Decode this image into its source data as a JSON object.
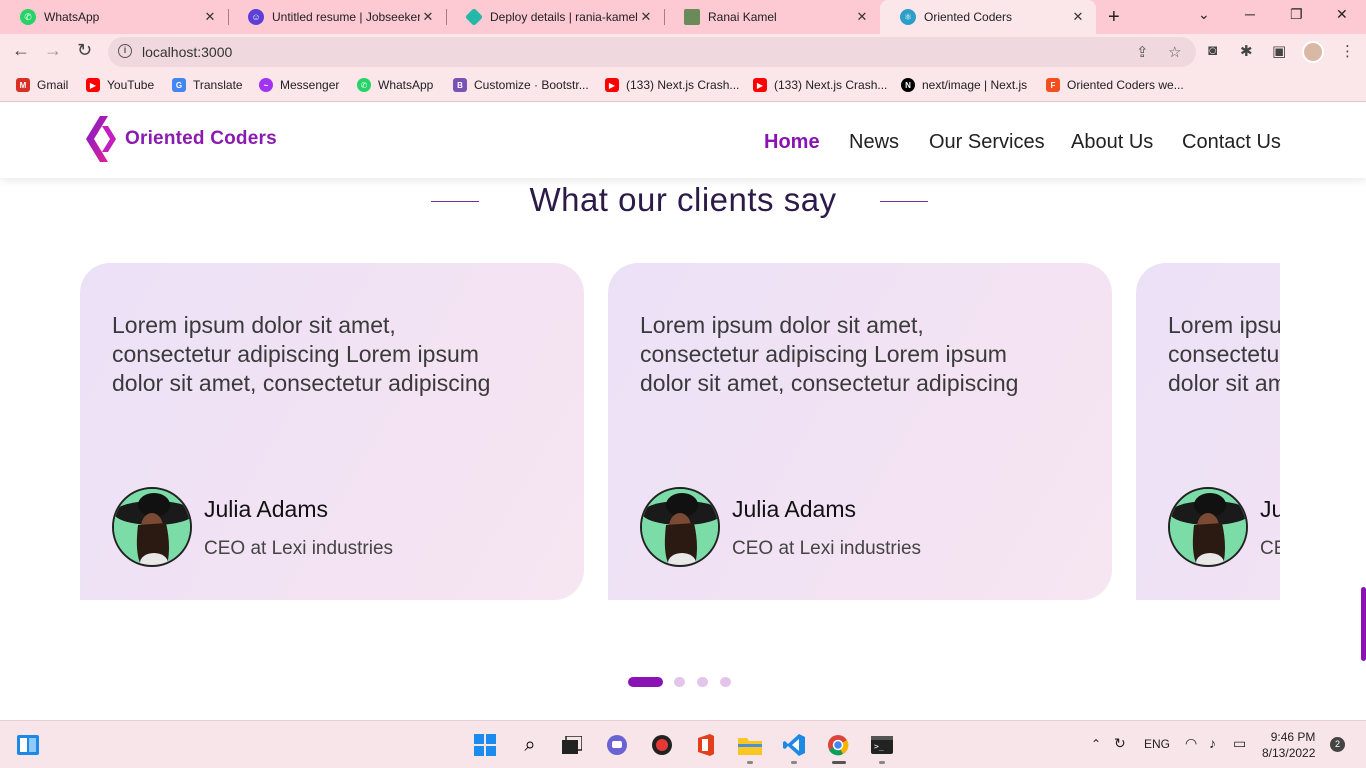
{
  "browser": {
    "tabs": [
      {
        "title": "WhatsApp",
        "icon": "whatsapp-icon",
        "color": "#25d366"
      },
      {
        "title": "Untitled resume | Jobseeker",
        "icon": "jobseeker-icon",
        "color": "#5b3fd8"
      },
      {
        "title": "Deploy details | rania-kamel-",
        "icon": "netlify-icon",
        "color": "#25b8a8"
      },
      {
        "title": "Ranai Kamel",
        "icon": "portfolio-icon",
        "color": "#6a8a5a"
      },
      {
        "title": "Oriented Coders",
        "icon": "react-icon",
        "color": "#2b9fc9"
      }
    ],
    "url": "localhost:3000",
    "bookmarks": [
      {
        "label": "Gmail",
        "icon": "gmail-icon",
        "color": "#d93025"
      },
      {
        "label": "YouTube",
        "icon": "youtube-icon",
        "color": "#ff0000"
      },
      {
        "label": "Translate",
        "icon": "translate-icon",
        "color": "#4285f4"
      },
      {
        "label": "Messenger",
        "icon": "messenger-icon",
        "color": "#a034f0"
      },
      {
        "label": "WhatsApp",
        "icon": "whatsapp-icon",
        "color": "#25d366"
      },
      {
        "label": "Customize · Bootstr...",
        "icon": "bootstrap-icon",
        "color": "#7952b3"
      },
      {
        "label": "(133) Next.js Crash...",
        "icon": "youtube-icon",
        "color": "#ff0000"
      },
      {
        "label": "(133) Next.js Crash...",
        "icon": "youtube-icon",
        "color": "#ff0000"
      },
      {
        "label": "next/image | Next.js",
        "icon": "nextjs-icon",
        "color": "#000000"
      },
      {
        "label": "Oriented Coders we...",
        "icon": "figma-icon",
        "color": "#f24e1e"
      }
    ]
  },
  "site": {
    "brand": "Oriented Coders",
    "brand_color": "#8b1bb0",
    "nav": [
      "Home",
      "News",
      "Our Services",
      "About Us",
      "Contact Us"
    ],
    "active_nav": "Home",
    "section_title": "What our clients say",
    "testimonials": [
      {
        "quote": "Lorem ipsum dolor sit amet, consectetur adipiscing Lorem ipsum dolor sit amet, consectetur adipiscing",
        "name": "Julia Adams",
        "role": "CEO at Lexi industries"
      },
      {
        "quote": "Lorem ipsum dolor sit amet, consectetur adipiscing Lorem ipsum dolor sit amet, consectetur adipiscing",
        "name": "Julia Adams",
        "role": "CEO at Lexi industries"
      },
      {
        "quote": "Lorem ipsum dolor sit amet, consectetur adipiscing Lorem ipsum dolor sit amet, consectetur adipiscing",
        "name": "Julia Adams",
        "role": "CEO at Lexi industries"
      }
    ],
    "carousel_dots": 4,
    "active_dot": 0
  },
  "taskbar": {
    "apps": [
      "start-icon",
      "search-icon",
      "task-view-icon",
      "teams-icon",
      "recorder-icon",
      "office-icon",
      "file-explorer-icon",
      "vscode-icon",
      "chrome-icon",
      "terminal-icon"
    ],
    "language": "ENG",
    "time": "9:46 PM",
    "date": "8/13/2022",
    "notifications": "2"
  }
}
